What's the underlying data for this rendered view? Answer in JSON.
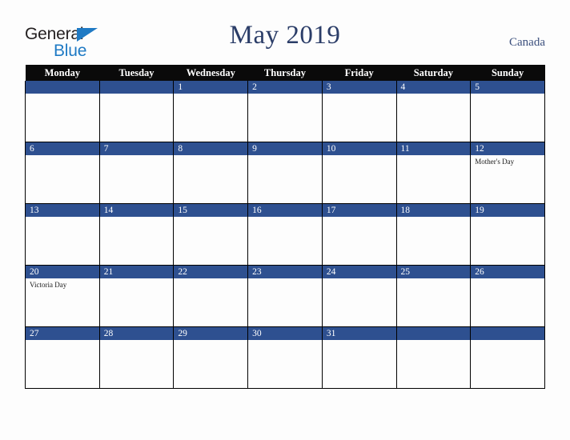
{
  "brand": {
    "name_part1": "General",
    "name_part2": "Blue",
    "triangle_color": "#1f7ac4"
  },
  "header": {
    "title": "May 2019",
    "region": "Canada",
    "title_color": "#2b3d68"
  },
  "theme": {
    "accent_blue": "#2e5090",
    "header_bar": "#0a0a0a",
    "page_background": "#fdfdfd",
    "grid_line": "#000000"
  },
  "calendar": {
    "month": "May",
    "year": "2019",
    "weekday_headers": [
      "Monday",
      "Tuesday",
      "Wednesday",
      "Thursday",
      "Friday",
      "Saturday",
      "Sunday"
    ],
    "weeks": [
      [
        {
          "day": "",
          "events": []
        },
        {
          "day": "",
          "events": []
        },
        {
          "day": "1",
          "events": []
        },
        {
          "day": "2",
          "events": []
        },
        {
          "day": "3",
          "events": []
        },
        {
          "day": "4",
          "events": []
        },
        {
          "day": "5",
          "events": []
        }
      ],
      [
        {
          "day": "6",
          "events": []
        },
        {
          "day": "7",
          "events": []
        },
        {
          "day": "8",
          "events": []
        },
        {
          "day": "9",
          "events": []
        },
        {
          "day": "10",
          "events": []
        },
        {
          "day": "11",
          "events": []
        },
        {
          "day": "12",
          "events": [
            "Mother's Day"
          ]
        }
      ],
      [
        {
          "day": "13",
          "events": []
        },
        {
          "day": "14",
          "events": []
        },
        {
          "day": "15",
          "events": []
        },
        {
          "day": "16",
          "events": []
        },
        {
          "day": "17",
          "events": []
        },
        {
          "day": "18",
          "events": []
        },
        {
          "day": "19",
          "events": []
        }
      ],
      [
        {
          "day": "20",
          "events": [
            "Victoria Day"
          ]
        },
        {
          "day": "21",
          "events": []
        },
        {
          "day": "22",
          "events": []
        },
        {
          "day": "23",
          "events": []
        },
        {
          "day": "24",
          "events": []
        },
        {
          "day": "25",
          "events": []
        },
        {
          "day": "26",
          "events": []
        }
      ],
      [
        {
          "day": "27",
          "events": []
        },
        {
          "day": "28",
          "events": []
        },
        {
          "day": "29",
          "events": []
        },
        {
          "day": "30",
          "events": []
        },
        {
          "day": "31",
          "events": []
        },
        {
          "day": "",
          "events": []
        },
        {
          "day": "",
          "events": []
        }
      ]
    ]
  }
}
